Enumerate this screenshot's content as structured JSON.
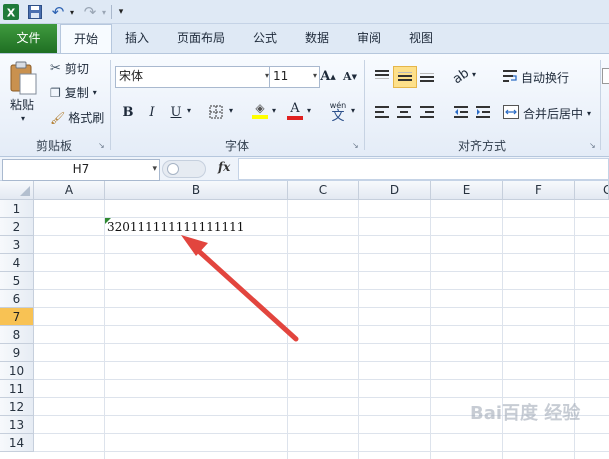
{
  "qat": {
    "excel_icon": "excel-logo-icon",
    "save": "save-icon",
    "undo": "undo-icon",
    "redo": "redo-icon"
  },
  "tabs": [
    {
      "label": "文件"
    },
    {
      "label": "开始"
    },
    {
      "label": "插入"
    },
    {
      "label": "页面布局"
    },
    {
      "label": "公式"
    },
    {
      "label": "数据"
    },
    {
      "label": "审阅"
    },
    {
      "label": "视图"
    }
  ],
  "ribbon": {
    "clipboard": {
      "paste": "粘贴",
      "cut": "剪切",
      "copy": "复制",
      "format_painter": "格式刷",
      "group": "剪贴板"
    },
    "font": {
      "name": "宋体",
      "size": "11",
      "bold": "B",
      "italic": "I",
      "underline": "U",
      "grow": "A",
      "shrink": "A",
      "font_color": "A",
      "phonetic": "wén",
      "phonetic2": "文",
      "group": "字体"
    },
    "alignment": {
      "wrap": "自动换行",
      "merge": "合并后居中",
      "group": "对齐方式"
    }
  },
  "formula_bar": {
    "name_box": "H7",
    "fx": "fx",
    "value": ""
  },
  "columns": [
    "A",
    "B",
    "C",
    "D",
    "E",
    "F",
    "G"
  ],
  "rows": [
    "1",
    "2",
    "3",
    "4",
    "5",
    "6",
    "7",
    "8",
    "9",
    "10",
    "11",
    "12",
    "13",
    "14"
  ],
  "selected_row": "7",
  "cells": {
    "B2": "320111111111111111"
  },
  "colors": {
    "file_tab": "#2f8a31",
    "arrow": "#e2453e",
    "selected_header": "#f8c254",
    "cell_error_mark": "#2f8a31"
  },
  "watermark": "Bai百度 经验"
}
